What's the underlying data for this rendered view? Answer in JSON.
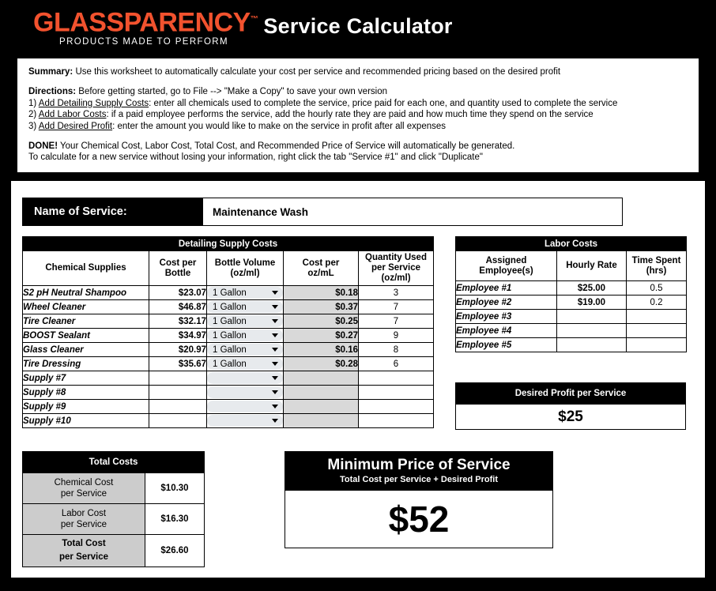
{
  "header": {
    "logo_word": "GLASSPARENCY",
    "logo_tm": "™",
    "logo_tagline": "PRODUCTS MADE TO PERFORM",
    "title": "Service Calculator",
    "logo_color": "#F2522E"
  },
  "info": {
    "summary_label": "Summary:",
    "summary_text": " Use this worksheet to automatically calculate your cost per service and recommended pricing based on the desired profit",
    "directions_label": "Directions:",
    "directions_text": " Before getting started, go to File --> \"Make a Copy\" to save your own version",
    "step1_num": "1) ",
    "step1_link": "Add Detailing Supply Costs",
    "step1_text": ": enter all chemicals used to complete the service, price paid for each one, and quantity used to complete the service",
    "step2_num": "2) ",
    "step2_link": "Add Labor Costs",
    "step2_text": ": if a paid employee performs the service, add the hourly rate they are paid and how much time they spend on the service",
    "step3_num": "3) ",
    "step3_link": "Add Desired Profit",
    "step3_text": ": enter the amount you would like to make on the service in profit after all expenses",
    "done_label": "DONE!",
    "done_text": " Your Chemical Cost, Labor Cost, Total Cost, and Recommended Price of Service will automatically be generated.",
    "done_text2": "To calculate for a new service without losing your information, right click the tab \"Service #1\" and click \"Duplicate\""
  },
  "service": {
    "label": "Name of Service:",
    "value": "Maintenance Wash"
  },
  "supply": {
    "banner": "Detailing Supply Costs",
    "columns": [
      "Chemical Supplies",
      "Cost per\nBottle",
      "Bottle Volume\n(oz/ml)",
      "Cost per\noz/mL",
      "Quantity Used\nper Service\n(oz/ml)"
    ],
    "columns_lines": [
      [
        "Chemical Supplies"
      ],
      [
        "Cost per",
        "Bottle"
      ],
      [
        "Bottle Volume",
        "(oz/ml)"
      ],
      [
        "Cost per",
        "oz/mL"
      ],
      [
        "Quantity Used",
        "per Service",
        "(oz/ml)"
      ]
    ],
    "dropdown_icon": "chevron-down-icon",
    "rows": [
      {
        "name": "S2 pH Neutral Shampoo",
        "cost": "$23.07",
        "volume": "1 Gallon",
        "per_oz": "$0.18",
        "qty": "3"
      },
      {
        "name": "Wheel Cleaner",
        "cost": "$46.87",
        "volume": "1 Gallon",
        "per_oz": "$0.37",
        "qty": "7"
      },
      {
        "name": "Tire Cleaner",
        "cost": "$32.17",
        "volume": "1 Gallon",
        "per_oz": "$0.25",
        "qty": "7"
      },
      {
        "name": "BOOST Sealant",
        "cost": "$34.97",
        "volume": "1 Gallon",
        "per_oz": "$0.27",
        "qty": "9"
      },
      {
        "name": "Glass Cleaner",
        "cost": "$20.97",
        "volume": "1 Gallon",
        "per_oz": "$0.16",
        "qty": "8"
      },
      {
        "name": "Tire Dressing",
        "cost": "$35.67",
        "volume": "1 Gallon",
        "per_oz": "$0.28",
        "qty": "6"
      },
      {
        "name": "Supply #7",
        "cost": "",
        "volume": "",
        "per_oz": "",
        "qty": ""
      },
      {
        "name": "Supply #8",
        "cost": "",
        "volume": "",
        "per_oz": "",
        "qty": ""
      },
      {
        "name": "Supply #9",
        "cost": "",
        "volume": "",
        "per_oz": "",
        "qty": ""
      },
      {
        "name": "Supply #10",
        "cost": "",
        "volume": "",
        "per_oz": "",
        "qty": ""
      }
    ]
  },
  "labor": {
    "banner": "Labor Costs",
    "columns_lines": [
      [
        "Assigned",
        "Employee(s)"
      ],
      [
        "Hourly Rate"
      ],
      [
        "Time Spent",
        "(hrs)"
      ]
    ],
    "rows": [
      {
        "name": "Employee #1",
        "rate": "$25.00",
        "time": "0.5"
      },
      {
        "name": "Employee #2",
        "rate": "$19.00",
        "time": "0.2"
      },
      {
        "name": "Employee #3",
        "rate": "",
        "time": ""
      },
      {
        "name": "Employee #4",
        "rate": "",
        "time": ""
      },
      {
        "name": "Employee #5",
        "rate": "",
        "time": ""
      }
    ]
  },
  "profit": {
    "banner": "Desired Profit per Service",
    "value": "$25"
  },
  "totals": {
    "banner": "Total Costs",
    "rows": [
      {
        "label_l1": "Chemical Cost",
        "label_l2": "per Service",
        "value": "$10.30"
      },
      {
        "label_l1": "Labor Cost",
        "label_l2": "per Service",
        "value": "$16.30"
      },
      {
        "label_l1": "Total Cost",
        "label_l2": "per Service",
        "value": "$26.60"
      }
    ]
  },
  "minimum_price": {
    "title": "Minimum Price of Service",
    "subtitle": "Total Cost per Service + Desired Profit",
    "value": "$52"
  },
  "colors": {
    "brand_orange": "#F2522E",
    "black": "#000000",
    "shaded_cell": "#D9D9D9",
    "totals_label": "#CCCCCC",
    "dropdown_pill": "#E7EAED"
  }
}
